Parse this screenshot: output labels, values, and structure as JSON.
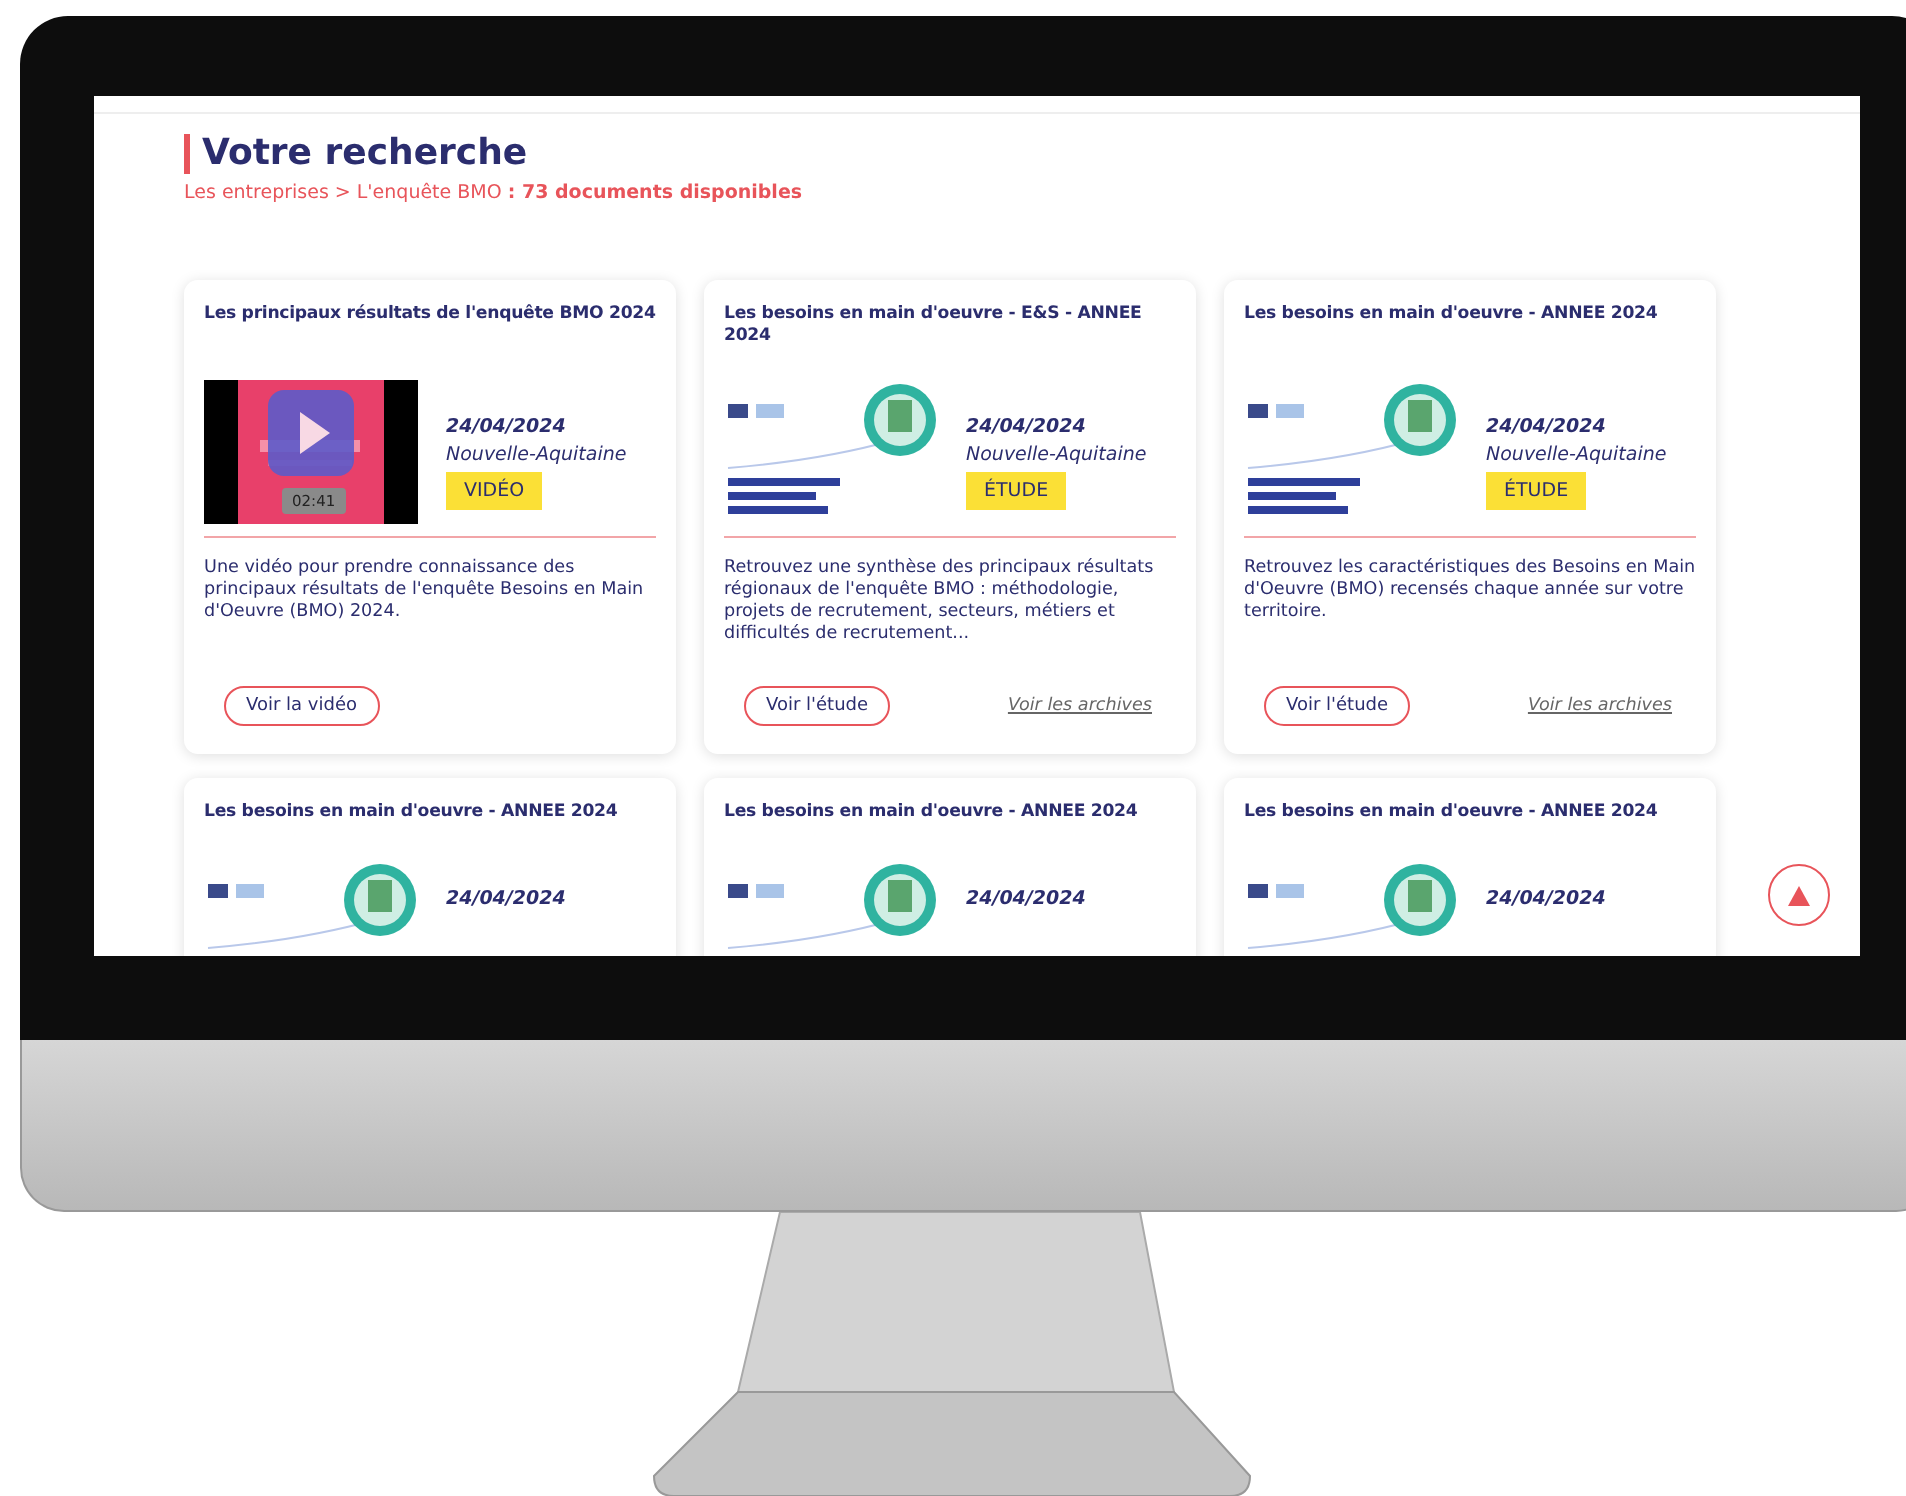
{
  "header": {
    "title": "Votre recherche",
    "breadcrumb": "Les entreprises > L'enquête BMO **: 73 documents disponibles**"
  },
  "cards": [
    {
      "title": "Les principaux résultats de l'enquête BMO 2024",
      "media": {
        "kind": "video",
        "duration": "02:41"
      },
      "date": "24/04/2024",
      "region": "Nouvelle-Aquitaine",
      "tag": "VIDÉO",
      "description": "Une vidéo pour prendre connaissance des principaux résultats de l'enquête Besoins en Main d'Oeuvre (BMO) 2024.",
      "action": "Voir la vidéo"
    },
    {
      "title": "Les besoins en main d'oeuvre - E&S - ANNEE 2024",
      "media": {
        "kind": "document"
      },
      "date": "24/04/2024",
      "region": "Nouvelle-Aquitaine",
      "tag": "ÉTUDE",
      "description": "Retrouvez une synthèse des principaux résultats régionaux de l'enquête BMO : méthodologie, projets de recrutement, secteurs, métiers et difficultés de recrutement...",
      "action": "Voir l'étude",
      "archives": "Voir les archives"
    },
    {
      "title": "Les besoins en main d'oeuvre - ANNEE 2024",
      "media": {
        "kind": "document"
      },
      "date": "24/04/2024",
      "region": "Nouvelle-Aquitaine",
      "tag": "ÉTUDE",
      "description": "Retrouvez les caractéristiques des Besoins en Main d'Oeuvre (BMO) recensés chaque année sur votre territoire.",
      "action": "Voir l'étude",
      "archives": "Voir les archives"
    },
    {
      "title": "Les besoins en main d'oeuvre - ANNEE 2024",
      "media": {
        "kind": "document"
      },
      "date": "24/04/2024"
    },
    {
      "title": "Les besoins en main d'oeuvre - ANNEE 2024",
      "media": {
        "kind": "document"
      },
      "date": "24/04/2024"
    },
    {
      "title": "Les besoins en main d'oeuvre - ANNEE 2024",
      "media": {
        "kind": "document"
      },
      "date": "24/04/2024"
    }
  ]
}
